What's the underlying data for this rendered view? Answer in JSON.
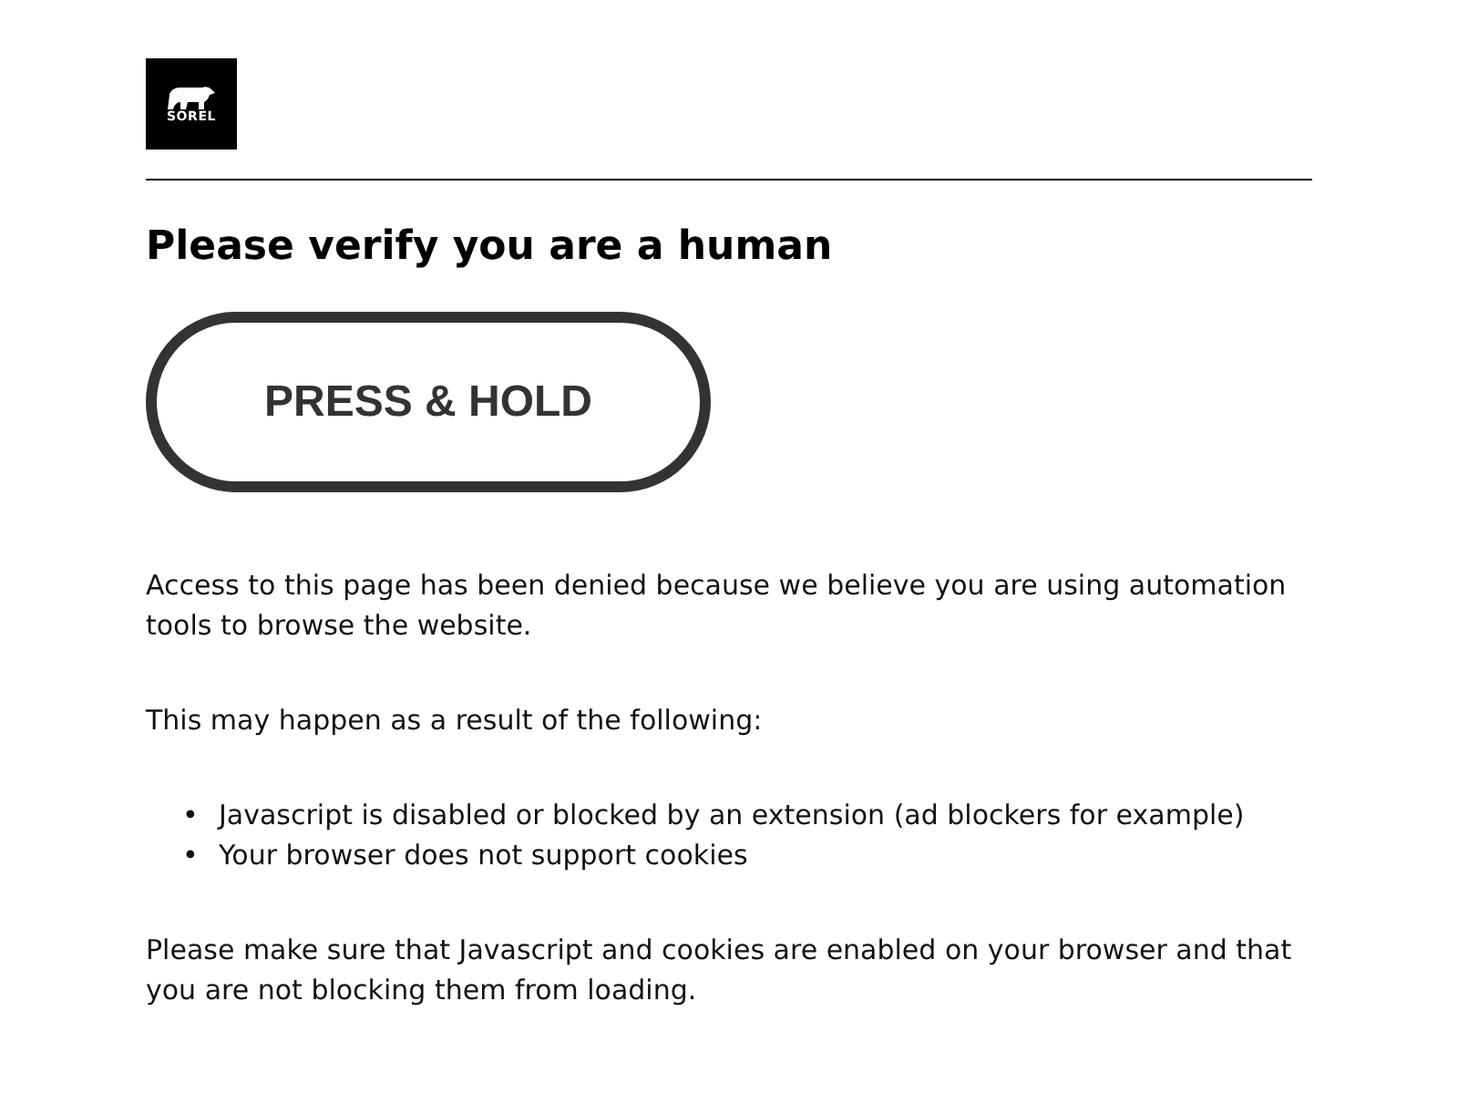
{
  "logo": {
    "text": "SOREL"
  },
  "heading": "Please verify you are a human",
  "hold_button": {
    "label": "PRESS & HOLD"
  },
  "paragraphs": [
    "Access to this page has been denied because we believe you are using automation tools to browse the website.",
    "This may happen as a result of the following:"
  ],
  "reasons": [
    {
      "bullet": "•",
      "text": "Javascript is disabled or blocked by an extension (ad blockers for example)"
    },
    {
      "bullet": "•",
      "text": "Your browser does not support cookies"
    }
  ],
  "closing": "Please make sure that Javascript and cookies are enabled on your browser and that you are not blocking them from loading."
}
